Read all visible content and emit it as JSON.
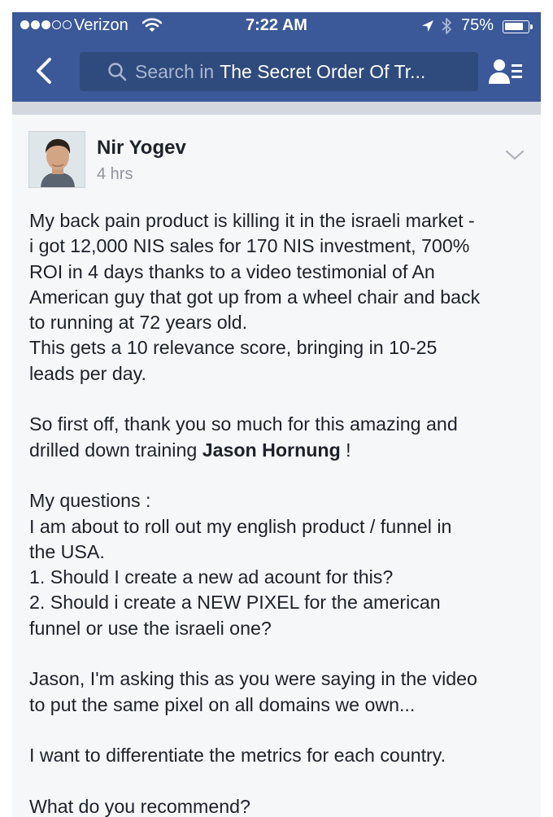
{
  "status_bar": {
    "carrier": "Verizon",
    "time": "7:22 AM",
    "battery": "75%",
    "icons": [
      "signal-dots",
      "wifi-icon",
      "location-arrow-icon",
      "bluetooth-icon",
      "battery-icon"
    ]
  },
  "nav": {
    "back_icon": "chevron-left-icon",
    "search_icon": "search-icon",
    "search_prefix": "Search in",
    "search_group": "The Secret Order Of Tr...",
    "members_icon": "member-list-icon"
  },
  "post": {
    "author": "Nir Yogev",
    "time": "4 hrs",
    "menu_icon": "chevron-down-icon",
    "body": {
      "p1_l1": "My back pain product is killing it in the israeli market -",
      "p1_l2": "i got 12,000 NIS sales for 170 NIS investment, 700%",
      "p1_l3": "ROI in 4 days thanks to a video testimonial of An",
      "p1_l4": "American guy that got up from a wheel chair and back",
      "p1_l5": "to running at 72 years old.",
      "p1_l6": "This gets a 10 relevance score, bringing in 10-25",
      "p1_l7": "leads per day.",
      "p2_l1": "So first off, thank you so much for this amazing and",
      "p2_l2_pre": "drilled down training ",
      "p2_mention": "Jason Hornung",
      "p2_l2_post": " !",
      "p3_l1": "My questions :",
      "p3_l2": "I am about to roll out my english product / funnel in",
      "p3_l3": "the USA.",
      "p3_l4": "1. Should I create a new ad acount for this?",
      "p3_l5": "2. Should i create a NEW PIXEL for the american",
      "p3_l6": "funnel or use the israeli one?",
      "p4_l1": "Jason, I'm asking this as you were saying in the video",
      "p4_l2": "to put the same pixel on all domains we own...",
      "p5_l1": "I want to differentiate the metrics for each country.",
      "p6_l1": "What do you recommend?"
    }
  },
  "colors": {
    "nav_bar": "#3b5998",
    "search_field": "#2f4a7d",
    "background": "#f6f7f8",
    "text": "#1d2129",
    "muted": "#90949c"
  }
}
